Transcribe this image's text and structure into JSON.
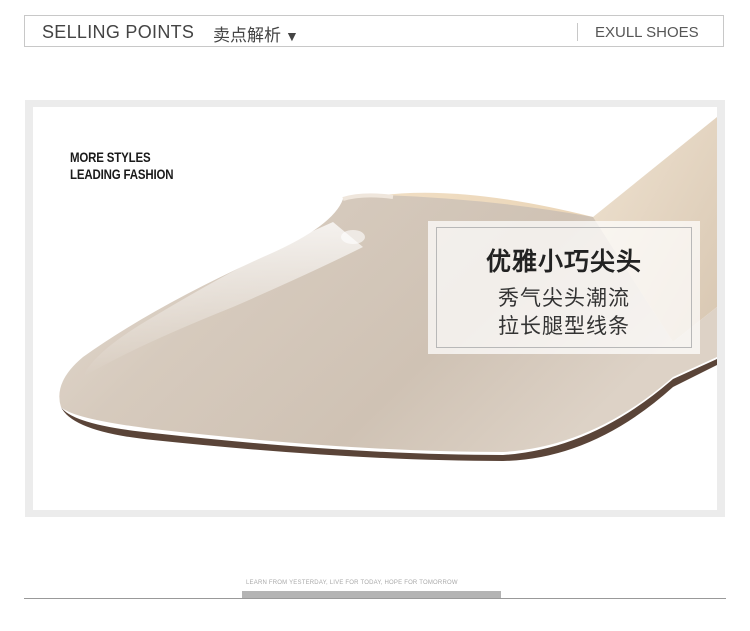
{
  "header": {
    "title": "SELLING POINTS",
    "subtitle": "卖点解析",
    "subtitle_arrow": "▼",
    "brand": "EXULL SHOES"
  },
  "hero": {
    "tagline_line1": "MORE STYLES",
    "tagline_line2": "LEADING FASHION",
    "feature_heading": "优雅小巧尖头",
    "feature_line1": "秀气尖头潮流",
    "feature_line2": "拉长腿型线条"
  },
  "footer": {
    "slogan": "LEARN FROM YESTERDAY, LIVE FOR TODAY, HOPE FOR TOMORROW"
  },
  "colors": {
    "shoe_patent": "#d9cfc3",
    "insole": "#f0dcc0",
    "sole": "#5a4438",
    "frame": "#ececec"
  }
}
